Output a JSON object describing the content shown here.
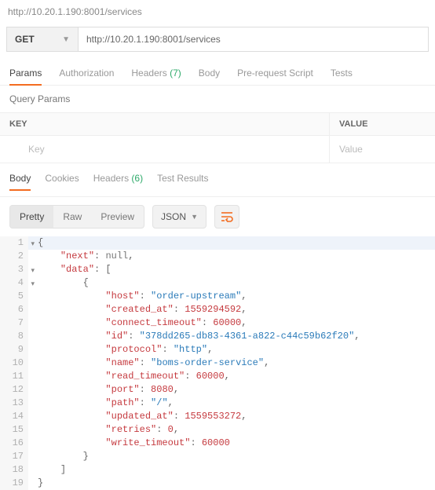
{
  "url_display": "http://10.20.1.190:8001/services",
  "request": {
    "method": "GET",
    "url": "http://10.20.1.190:8001/services"
  },
  "req_tabs": {
    "params": "Params",
    "auth": "Authorization",
    "headers": "Headers",
    "headers_count": "(7)",
    "body": "Body",
    "prereq": "Pre-request Script",
    "tests": "Tests",
    "active": "params"
  },
  "query_params": {
    "title": "Query Params",
    "key_header": "KEY",
    "value_header": "VALUE",
    "key_placeholder": "Key",
    "value_placeholder": "Value"
  },
  "resp_tabs": {
    "body": "Body",
    "cookies": "Cookies",
    "headers": "Headers",
    "headers_count": "(6)",
    "results": "Test Results",
    "active": "body"
  },
  "viewer": {
    "pretty": "Pretty",
    "raw": "Raw",
    "preview": "Preview",
    "format": "JSON"
  },
  "code_lines": {
    "l1": "{",
    "l2": "    \"next\": null,",
    "l3": "    \"data\": [",
    "l4": "        {",
    "l5": "            \"host\": \"order-upstream\",",
    "l6": "            \"created_at\": 1559294592,",
    "l7": "            \"connect_timeout\": 60000,",
    "l8": "            \"id\": \"378dd265-db83-4361-a822-c44c59b62f20\",",
    "l9": "            \"protocol\": \"http\",",
    "l10": "            \"name\": \"boms-order-service\",",
    "l11": "            \"read_timeout\": 60000,",
    "l12": "            \"port\": 8080,",
    "l13": "            \"path\": \"/\",",
    "l14": "            \"updated_at\": 1559553272,",
    "l15": "            \"retries\": 0,",
    "l16": "            \"write_timeout\": 60000",
    "l17": "        }",
    "l18": "    ]",
    "l19": "}"
  },
  "chart_data": {
    "type": "table",
    "title": "Kong /services response",
    "next": null,
    "data": [
      {
        "host": "order-upstream",
        "created_at": 1559294592,
        "connect_timeout": 60000,
        "id": "378dd265-db83-4361-a822-c44c59b62f20",
        "protocol": "http",
        "name": "boms-order-service",
        "read_timeout": 60000,
        "port": 8080,
        "path": "/",
        "updated_at": 1559553272,
        "retries": 0,
        "write_timeout": 60000
      }
    ]
  }
}
